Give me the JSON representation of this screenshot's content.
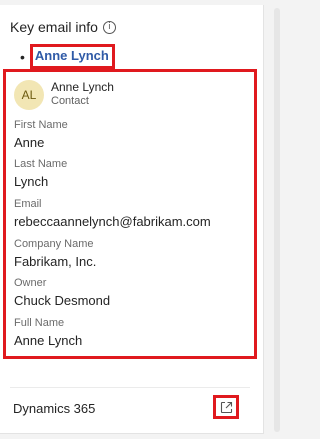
{
  "section": {
    "title": "Key email info",
    "info_icon": "info-icon"
  },
  "contact_link": {
    "bullet": "•",
    "label": "Anne Lynch"
  },
  "contact_card": {
    "avatar_initials": "AL",
    "name": "Anne Lynch",
    "type": "Contact",
    "fields": [
      {
        "label": "First Name",
        "value": "Anne"
      },
      {
        "label": "Last Name",
        "value": "Lynch"
      },
      {
        "label": "Email",
        "value": "rebeccaannelynch@fabrikam.com"
      },
      {
        "label": "Company Name",
        "value": "Fabrikam, Inc."
      },
      {
        "label": "Owner",
        "value": "Chuck Desmond"
      },
      {
        "label": "Full Name",
        "value": "Anne Lynch"
      }
    ]
  },
  "footer": {
    "label": "Dynamics 365",
    "open_icon": "open-in-new-window-icon"
  },
  "colors": {
    "highlight": "#e0191e",
    "link": "#2f5aa7",
    "avatar_bg": "#f2e6b4"
  }
}
